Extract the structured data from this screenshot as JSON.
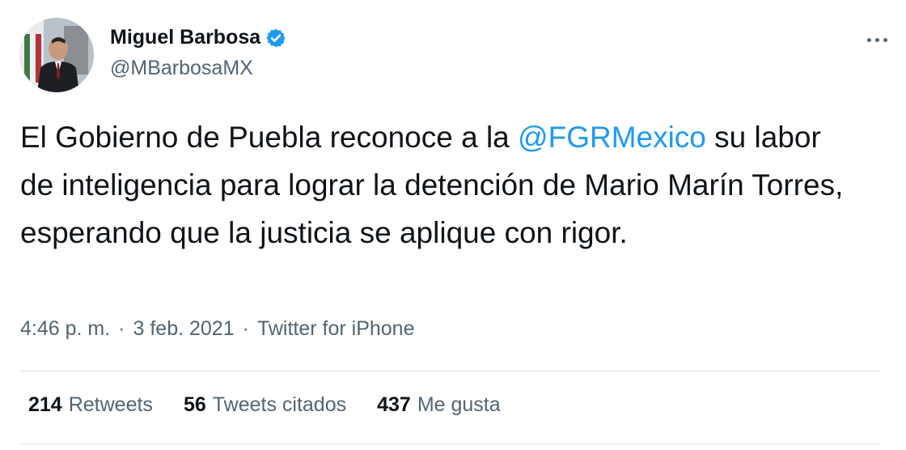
{
  "author": {
    "display_name": "Miguel Barbosa",
    "handle": "@MBarbosaMX",
    "verified": true,
    "verified_color": "#1d9bf0"
  },
  "tweet": {
    "text_before": "El Gobierno de Puebla reconoce a la ",
    "mention": "@FGRMexico",
    "text_after": " su labor de inteligencia para lograr la detención de Mario Marín Torres, esperando que la justicia se aplique con rigor."
  },
  "meta": {
    "time": "4:46 p. m.",
    "separator": "·",
    "date": "3 feb. 2021",
    "source": "Twitter for iPhone"
  },
  "stats": {
    "retweets_count": "214",
    "retweets_label": "Retweets",
    "quotes_count": "56",
    "quotes_label": "Tweets citados",
    "likes_count": "437",
    "likes_label": "Me gusta"
  },
  "icons": {
    "more": "more-options-icon",
    "verified": "verified-badge-icon"
  },
  "colors": {
    "link": "#1d9bf0",
    "secondary_text": "#536471",
    "primary_text": "#0f1419"
  }
}
